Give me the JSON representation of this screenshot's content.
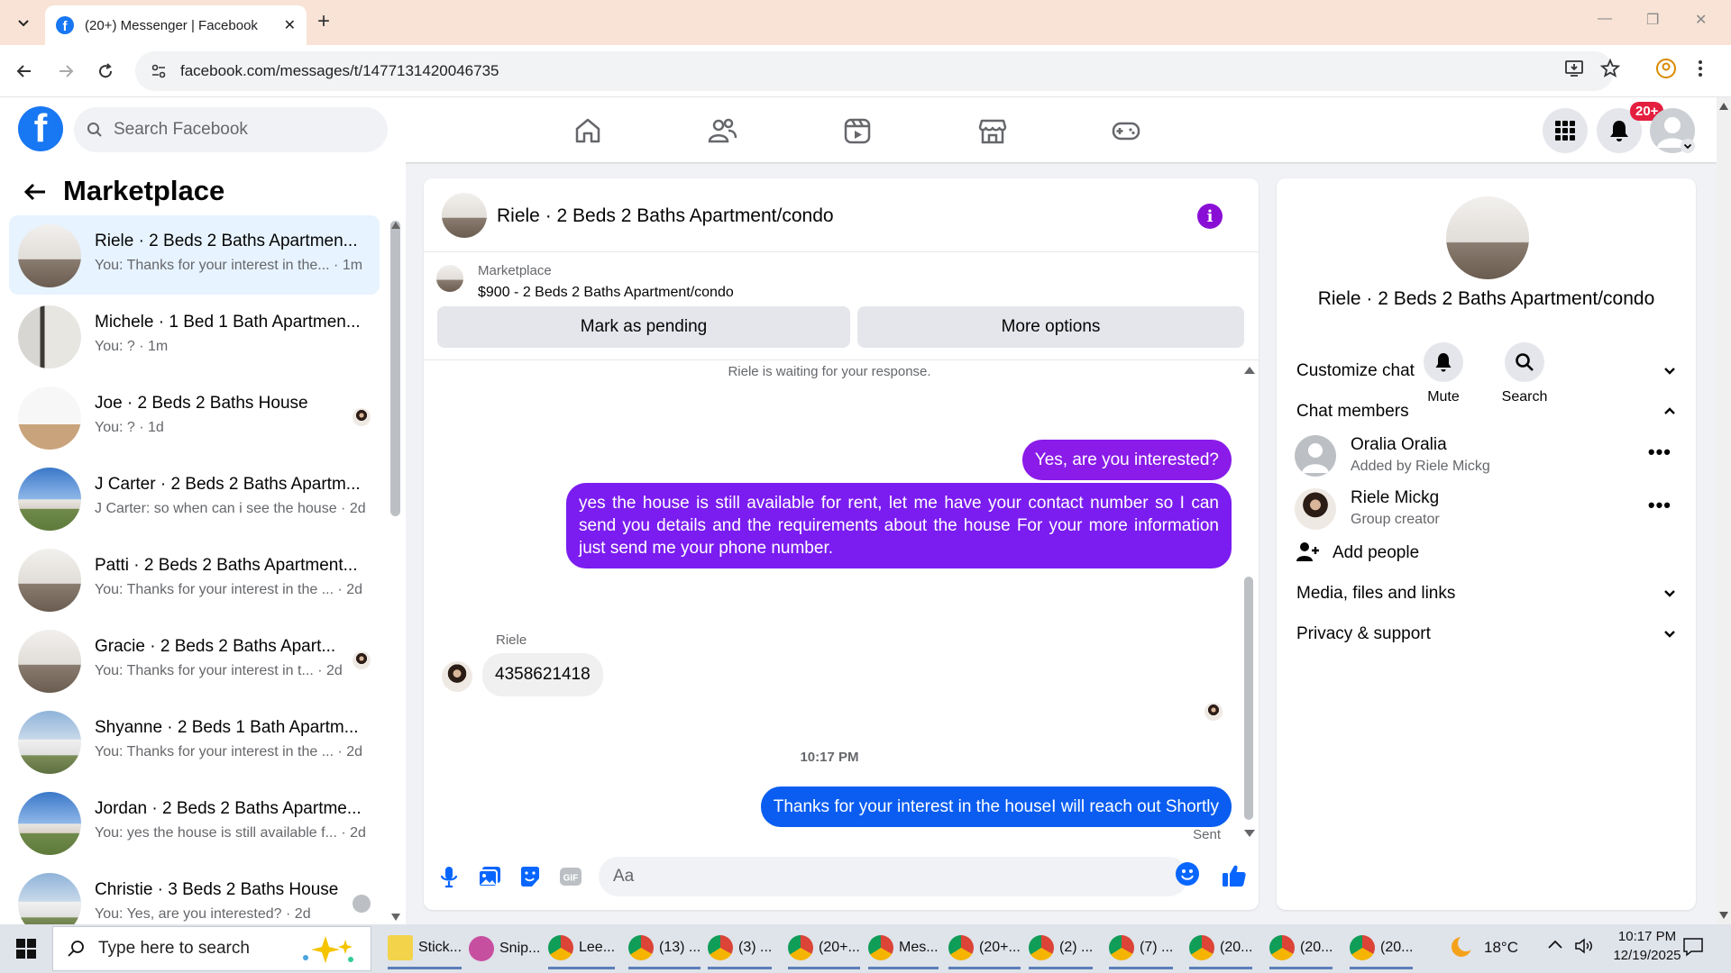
{
  "browser": {
    "tab_title": "(20+) Messenger | Facebook",
    "url": "facebook.com/messages/t/1477131420046735"
  },
  "facebook": {
    "search_placeholder": "Search Facebook",
    "notification_badge": "20+"
  },
  "left": {
    "title": "Marketplace",
    "conversations": [
      {
        "name": "Riele · 2 Beds 2 Baths Apartmen...",
        "snippet": "You: Thanks for your interest in the... · 1m"
      },
      {
        "name": "Michele · 1 Bed 1 Bath Apartmen...",
        "snippet": "You: ? · 1m"
      },
      {
        "name": "Joe · 2 Beds 2 Baths House",
        "snippet": "You: ? · 1d"
      },
      {
        "name": "J Carter · 2 Beds 2 Baths Apartm...",
        "snippet": "J Carter: so when can i see the house · 2d"
      },
      {
        "name": "Patti · 2 Beds 2 Baths Apartment...",
        "snippet": "You: Thanks for your interest in the ... · 2d"
      },
      {
        "name": "Gracie · 2 Beds 2 Baths Apart...",
        "snippet": "You: Thanks for your interest in t... · 2d"
      },
      {
        "name": "Shyanne · 2 Beds 1 Bath Apartm...",
        "snippet": "You: Thanks for your interest in the ... · 2d"
      },
      {
        "name": "Jordan · 2 Beds 2 Baths Apartme...",
        "snippet": "You: yes the house is still available f... · 2d"
      },
      {
        "name": "Christie · 3 Beds 2 Baths House",
        "snippet": "You: Yes, are you interested? · 2d"
      }
    ]
  },
  "chat": {
    "title": "Riele · 2 Beds 2 Baths Apartment/condo",
    "marketplace_label": "Marketplace",
    "listing": "$900 - 2 Beds 2 Baths Apartment/condo",
    "mark_pending": "Mark as pending",
    "more_options": "More options",
    "waiting": "Riele is waiting for your response.",
    "msg_out_1": "Yes, are you interested?",
    "msg_out_2": "yes the house is still available for rent, let me have your contact number so I can send you details and the requirements about the house For  your  more  information  just  send  me   your  phone  number.",
    "in_sender": "Riele",
    "msg_in_1": "4358621418",
    "time": "10:17 PM",
    "msg_out_3": "Thanks for your interest in the houseI will reach out Shortly",
    "sent": "Sent",
    "composer_placeholder": "Aa"
  },
  "info": {
    "title": "Riele · 2 Beds 2 Baths Apartment/condo",
    "mute": "Mute",
    "search": "Search",
    "customize": "Customize chat",
    "members_header": "Chat members",
    "members": [
      {
        "name": "Oralia Oralia",
        "sub": "Added by Riele Mickg"
      },
      {
        "name": "Riele Mickg",
        "sub": "Group creator"
      }
    ],
    "add_people": "Add people",
    "media": "Media, files and links",
    "privacy": "Privacy & support"
  },
  "taskbar": {
    "search": "Type here to search",
    "apps": [
      "Stick...",
      "Snip...",
      "Lee...",
      "(13) ...",
      "(3) ...",
      "(20+...",
      "Mes...",
      "(20+...",
      "(2) ...",
      "(7) ...",
      "(20...",
      "(20...",
      "(20..."
    ],
    "weather": "18°C",
    "time": "10:17 PM",
    "date": "12/19/2025"
  }
}
